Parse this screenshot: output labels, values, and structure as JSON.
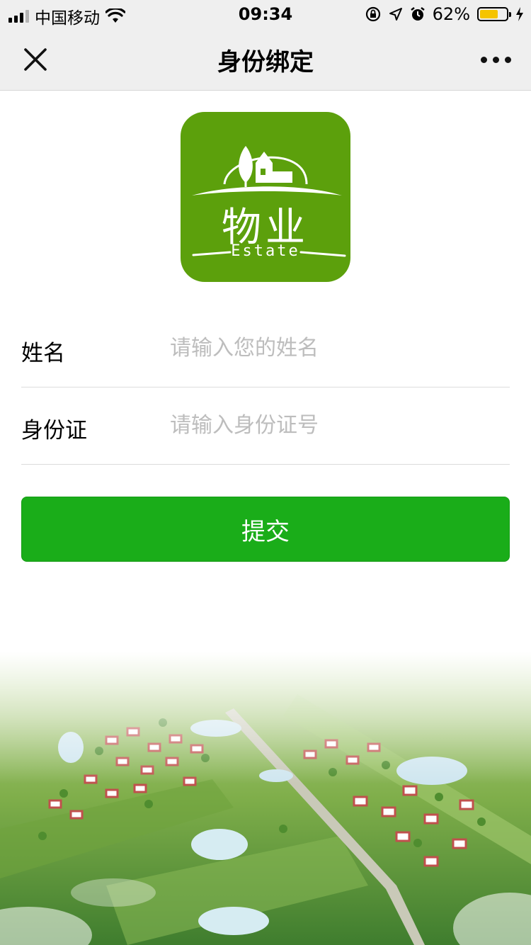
{
  "status_bar": {
    "carrier": "中国移动",
    "time": "09:34",
    "battery_percent": "62%",
    "battery_level": 0.62
  },
  "nav": {
    "title": "身份绑定",
    "close_icon": "close-icon",
    "more_icon": "more-icon"
  },
  "logo": {
    "main_text": "物业",
    "sub_text": "Estate"
  },
  "form": {
    "name": {
      "label": "姓名",
      "placeholder": "请输入您的姓名",
      "value": ""
    },
    "id_card": {
      "label": "身份证",
      "placeholder": "请输入身份证号",
      "value": ""
    }
  },
  "submit_label": "提交",
  "colors": {
    "primary": "#1aad19",
    "logo_bg": "#5ca00c",
    "bar_bg": "#efefef",
    "battery": "#f5c400"
  }
}
